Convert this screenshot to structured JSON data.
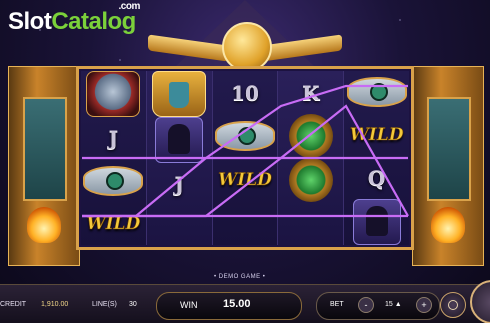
{
  "logo": {
    "part1": "Slot",
    "part2": "Catalog",
    "suffix": ".com"
  },
  "reels": [
    [
      "eagle",
      "J",
      "eye",
      "WILD"
    ],
    [
      "pharaoh",
      "anubis",
      "J",
      ""
    ],
    [
      "10",
      "eye",
      "WILD",
      ""
    ],
    [
      "K",
      "scarab",
      "scarab",
      ""
    ],
    [
      "eye",
      "WILD",
      "Q",
      "anubis"
    ]
  ],
  "wild_label": "WILD",
  "demo_label": "• DEMO GAME •",
  "bottom_bar": {
    "credit_label": "CREDIT",
    "credit_value": "1,910.00",
    "lines_label": "LINE(S)",
    "lines_value": "30",
    "win_label": "WIN",
    "win_value": "15.00",
    "bet_label": "BET",
    "bet_minus": "-",
    "bet_value": "15 ▲",
    "bet_plus": "+"
  },
  "colors": {
    "winline": "#c86cf5",
    "wild_text": "#f3c93b",
    "gold_frame": "#d9a24a",
    "logo_green": "#7bd13a"
  }
}
